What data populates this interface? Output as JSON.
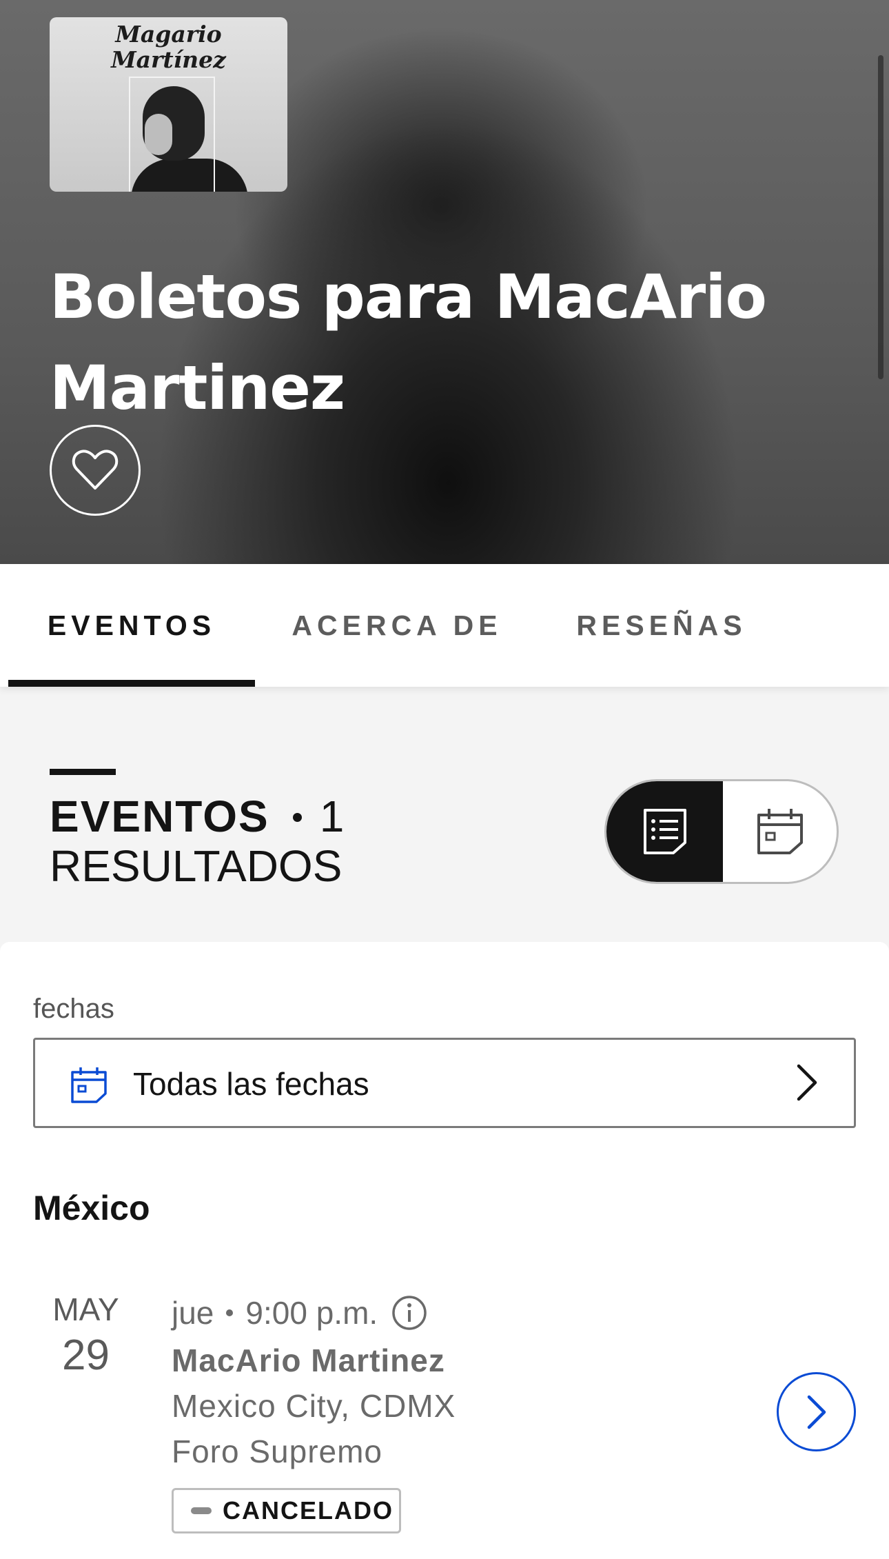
{
  "hero": {
    "album_art_text": [
      "Magario",
      "Martínez"
    ],
    "title": "Boletos para MacArio Martinez",
    "favorite_icon": "heart-outline-icon"
  },
  "tabs": [
    {
      "label": "EVENTOS",
      "active": true
    },
    {
      "label": "ACERCA DE",
      "active": false
    },
    {
      "label": "RESEÑAS",
      "active": false
    }
  ],
  "results": {
    "heading": "EVENTOS",
    "count": "1",
    "suffix": "RESULTADOS",
    "view_modes": [
      {
        "icon": "list-view-icon",
        "selected": true
      },
      {
        "icon": "calendar-view-icon",
        "selected": false
      }
    ]
  },
  "filters": {
    "label": "fechas",
    "value": "Todas las fechas",
    "icon": "calendar-icon"
  },
  "country": "México",
  "events": [
    {
      "month": "MAY",
      "day": "29",
      "weekday": "jue",
      "time": "9:00 p.m.",
      "name": "MacArio Martinez",
      "city": "Mexico City, CDMX",
      "venue": "Foro Supremo",
      "status": "CANCELADO"
    }
  ],
  "colors": {
    "accent_blue": "#0a4bd4",
    "text_dark": "#141414",
    "muted": "#6a6a6a"
  }
}
